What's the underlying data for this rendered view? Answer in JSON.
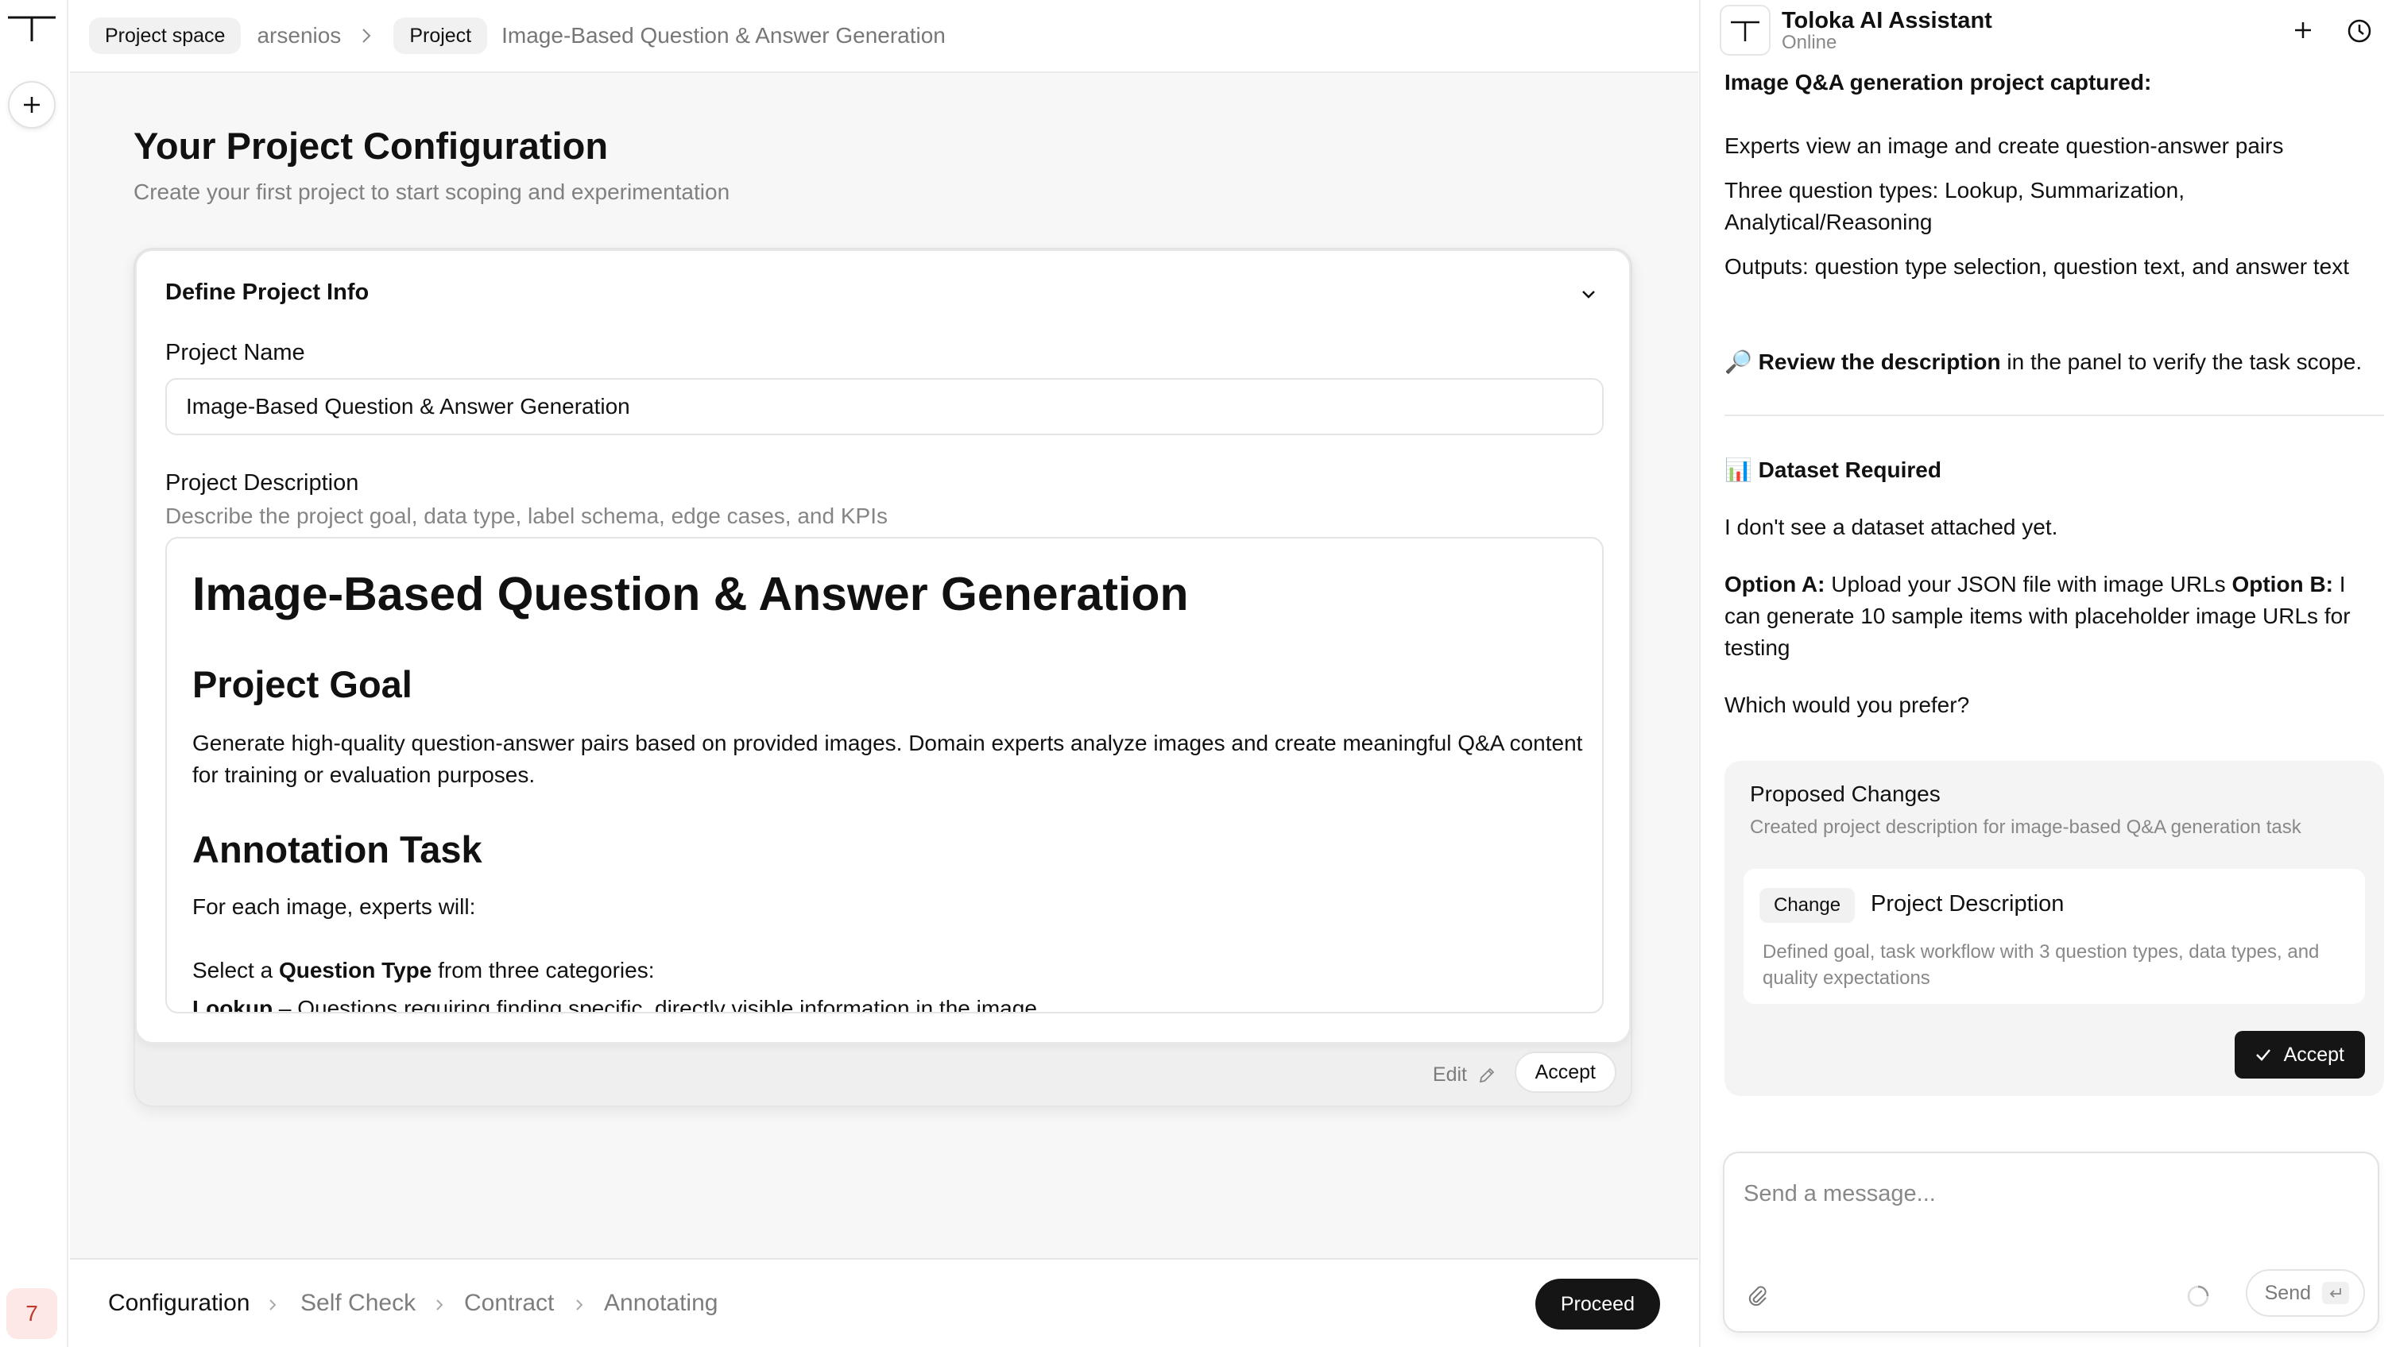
{
  "breadcrumb": {
    "chip1": "Project space",
    "workspace": "arsenios",
    "chip2": "Project",
    "title": "Image-Based Question & Answer Generation"
  },
  "rail": {
    "badge": "7"
  },
  "page": {
    "title": "Your Project Configuration",
    "subtitle": "Create your first project to start scoping and experimentation"
  },
  "card": {
    "header": "Define Project Info",
    "name_label": "Project Name",
    "name_value": "Image-Based Question & Answer Generation",
    "desc_label": "Project Description",
    "desc_hint": "Describe the project goal, data type, label schema, edge cases, and KPIs",
    "desc": {
      "h1": "Image-Based Question & Answer Generation",
      "goal_heading": "Project Goal",
      "goal_text": "Generate high-quality question-answer pairs based on provided images. Domain experts analyze images and create meaningful Q&A content for training or evaluation purposes.",
      "task_heading": "Annotation Task",
      "task_intro": "For each image, experts will:",
      "select_prefix": "Select a ",
      "select_bold": "Question Type",
      "select_suffix": " from three categories:",
      "lookup_bold": "Lookup",
      "lookup_text": " – Questions requiring finding specific, directly visible information in the image"
    },
    "edit_label": "Edit",
    "accept_label": "Accept"
  },
  "steps": {
    "items": [
      "Configuration",
      "Self Check",
      "Contract",
      "Annotating"
    ],
    "proceed": "Proceed"
  },
  "assistant": {
    "title": "Toloka AI Assistant",
    "status": "Online",
    "msg_captured": "Image Q&A generation project captured:",
    "msg_p1": "Experts view an image and create question-answer pairs",
    "msg_p2": "Three question types: Lookup, Summarization, Analytical/Reasoning",
    "msg_p3": "Outputs: question type selection, question text, and answer text",
    "review_emoji": "🔎",
    "review_bold": "Review the description",
    "review_text": " in the panel to verify the task scope.",
    "dataset_emoji": "📊",
    "dataset_heading": "Dataset Required",
    "dataset_text": "I don't see a dataset attached yet.",
    "optA_bold": "Option A:",
    "optA_text": " Upload your JSON file with image URLs ",
    "optB_bold": "Option B:",
    "optB_text": " I can generate 10 sample items with placeholder image URLs for testing",
    "prefer": "Which would you prefer?",
    "proposed": {
      "title": "Proposed Changes",
      "subtitle": "Created project description for image-based Q&A generation task",
      "chip": "Change",
      "item_title": "Project Description",
      "item_desc": "Defined goal, task workflow with 3 question types, data types, and quality expectations",
      "accept": "Accept"
    },
    "composer": {
      "placeholder": "Send a message...",
      "send": "Send"
    }
  }
}
